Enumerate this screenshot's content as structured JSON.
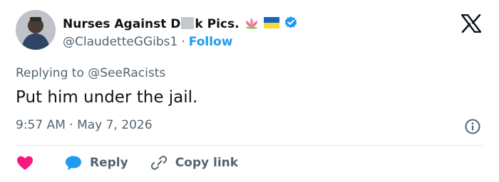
{
  "author": {
    "name_start": "Nurses Against D",
    "name_end": "k Pics.",
    "handle": "@ClaudetteGGibs1",
    "separator": "·",
    "follow_label": "Follow",
    "badge_emojis": [
      "lotus-emoji",
      "ukraine-flag-emoji",
      "verified-badge-icon"
    ]
  },
  "tweet": {
    "replying_to": "Replying to @SeeRacists",
    "text": "Put him under the jail.",
    "time": "9:57 AM · May 7, 2026"
  },
  "actions": {
    "reply_label": "Reply",
    "copy_link_label": "Copy link"
  },
  "colors": {
    "accent": "#1d9bf0",
    "heart": "#f91880",
    "muted": "#536471",
    "text": "#0f1419"
  }
}
